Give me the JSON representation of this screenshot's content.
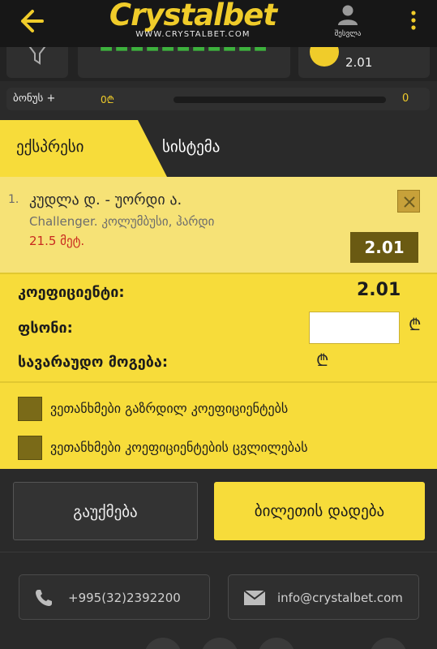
{
  "header": {
    "logo_text": "Crystalbet",
    "logo_url": "WWW.CRYSTALBET.COM",
    "profile_label": "შესვლა"
  },
  "subrow": {
    "odds": "2.01"
  },
  "bonus": {
    "label": "ბონუს +",
    "amount": "0₾",
    "right_value": "0"
  },
  "tabs": {
    "express": "ექსპრესი",
    "system": "სისტემა"
  },
  "bet": {
    "number": "1.",
    "match": "კუდლა დ. - უორდი ა.",
    "league": "Challenger. კოლუმბუსი, ჰარდი",
    "market": "21.5 მეტ.",
    "odds": "2.01",
    "remove_symbol": "✕"
  },
  "summary": {
    "coef_label": "კოეფიციენტი:",
    "coef_value": "2.01",
    "stake_label": "ფსონი:",
    "stake_value": "",
    "win_label": "სავარაუდო მოგება:",
    "currency_symbol": "₾"
  },
  "options": {
    "accept_increased": "ვეთანხმები გაზრდილ კოეფიციენტებს",
    "accept_changes": "ვეთანხმები კოეფიციენტების ცვლილებას"
  },
  "actions": {
    "cancel": "გაუქმება",
    "place": "ბილეთის დადება"
  },
  "contacts": {
    "phone": "+995(32)2392200",
    "email": "info@crystalbet.com"
  },
  "colors": {
    "accent": "#f7dc3a",
    "dark": "#2a2a2a",
    "market_red": "#c92a1f"
  }
}
